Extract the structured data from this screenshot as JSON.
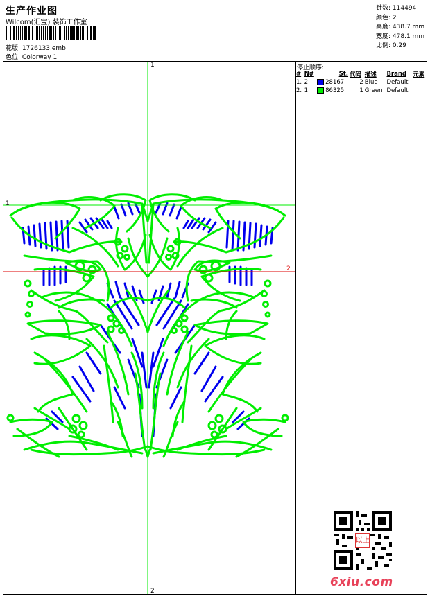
{
  "header": {
    "title": "生产作业图",
    "studio": "Wilcom(汇宝) 装饰工作室",
    "design_label": "花版:",
    "design_value": "1726133.emb",
    "colorway_label": "色位:",
    "colorway_value": "Colorway 1"
  },
  "stats": {
    "stitches_label": "针数:",
    "stitches_value": "114494",
    "colors_label": "颜色:",
    "colors_value": "2",
    "height_label": "高度:",
    "height_value": "438.7 mm",
    "width_label": "宽度:",
    "width_value": "478.1 mm",
    "scale_label": "比例:",
    "scale_value": "0.29"
  },
  "sequence": {
    "title": "停止顺序:",
    "headers": [
      "#",
      "N#",
      "St.",
      "代码",
      "描述",
      "Brand",
      "元素"
    ],
    "rows": [
      {
        "index": "1.",
        "n": "2",
        "color": "#0000ee",
        "stitches": "28167",
        "code": "2",
        "description": "Blue",
        "brand": "Default"
      },
      {
        "index": "2.",
        "n": "1",
        "color": "#00ee00",
        "stitches": "86325",
        "code": "1",
        "description": "Green",
        "brand": "Default"
      }
    ]
  },
  "axes": {
    "v_top_label": "1",
    "v_bottom_label": "2",
    "h_green_label": "1",
    "h_red_label": "2"
  },
  "colors": {
    "green": "#00ee00",
    "blue": "#0000ee",
    "red": "#dd0000",
    "watermark": "#e8435a"
  },
  "watermark": {
    "text": "6xiu.com",
    "stamp_text": "以上"
  }
}
